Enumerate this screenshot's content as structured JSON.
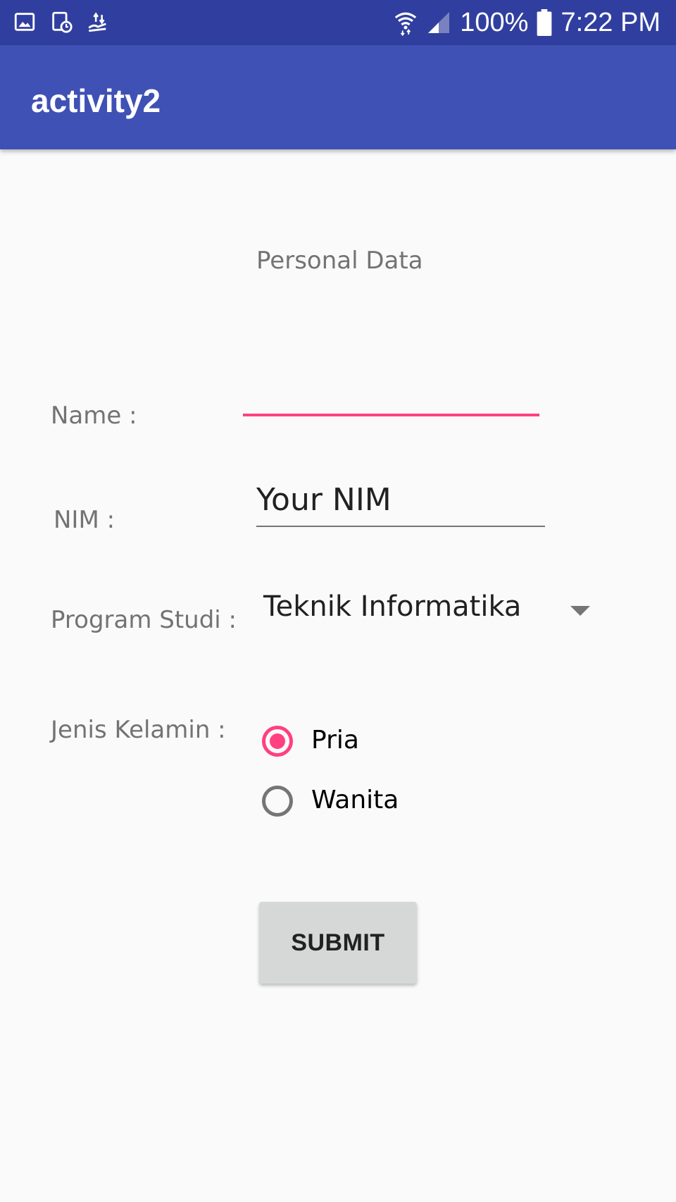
{
  "status_bar": {
    "battery": "100%",
    "time": "7:22 PM",
    "left_icons": [
      "gallery-icon",
      "screenshot-icon",
      "usb-transfer-icon"
    ],
    "right_icons": [
      "wifi-icon",
      "signal-icon",
      "battery-icon"
    ]
  },
  "app_bar": {
    "title": "activity2",
    "color": "#3f51b5"
  },
  "form": {
    "heading": "Personal Data",
    "name_label": "Name :",
    "name_value": "",
    "nim_label": "NIM :",
    "nim_value": "Your NIM",
    "program_label": "Program Studi :",
    "program_value": "Teknik Informatika",
    "gender_label": "Jenis Kelamin :",
    "gender_options": [
      {
        "label": "Pria",
        "checked": true
      },
      {
        "label": "Wanita",
        "checked": false
      }
    ],
    "submit_label": "SUBMIT"
  },
  "colors": {
    "primary_dark": "#303f9f",
    "primary": "#3f51b5",
    "accent": "#ff4081"
  }
}
